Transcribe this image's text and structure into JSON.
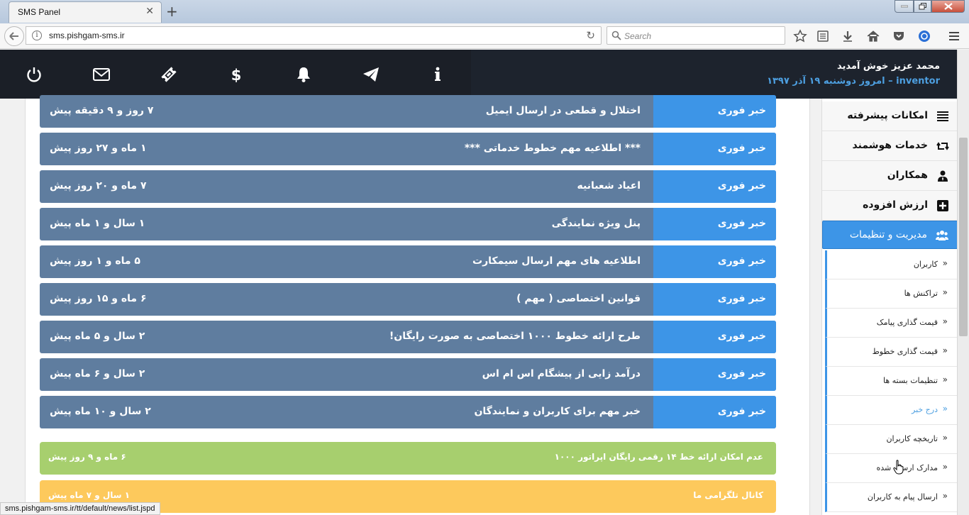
{
  "browser": {
    "tab_title": "SMS Panel",
    "url": "sms.pishgam-sms.ir",
    "search_placeholder": "Search",
    "status_url": "sms.pishgam-sms.ir/tt/default/news/list.jspd"
  },
  "header": {
    "welcome": "محمد عزیز خوش آمدید",
    "username": "inventor",
    "date_text": "– امروز دوشنبه ۱۹ آذر ۱۳۹۷",
    "icons": [
      "power-icon",
      "mail-icon",
      "ticket-icon",
      "dollar-icon",
      "bell-icon",
      "send-icon",
      "info-icon"
    ]
  },
  "news": [
    {
      "badge": "خبر فوری",
      "title": "اختلال و قطعی در ارسال ایمیل",
      "time": "۷ روز و ۹ دقیقه پیش"
    },
    {
      "badge": "خبر فوری",
      "title": "*** اطلاعیه مهم خطوط خدماتی ***",
      "time": "۱ ماه و ۲۷ روز پیش"
    },
    {
      "badge": "خبر فوری",
      "title": "اعیاد شعبانیه",
      "time": "۷ ماه و ۲۰ روز پیش"
    },
    {
      "badge": "خبر فوری",
      "title": "پنل ویژه نمایندگی",
      "time": "۱ سال و ۱ ماه پیش"
    },
    {
      "badge": "خبر فوری",
      "title": "اطلاعیه های مهم ارسال سیمکارت",
      "time": "۵ ماه و ۱ روز پیش"
    },
    {
      "badge": "خبر فوری",
      "title": "قوانین اختصاصی ( مهم )",
      "time": "۶ ماه و ۱۵ روز پیش"
    },
    {
      "badge": "خبر فوری",
      "title": "طرح ارائه خطوط ۱۰۰۰ اختصاصی به صورت رایگان!",
      "time": "۲ سال و ۵ ماه پیش"
    },
    {
      "badge": "خبر فوری",
      "title": "درآمد زایی از پیشگام اس ام اس",
      "time": "۲ سال و ۶ ماه پیش"
    },
    {
      "badge": "خبر فوری",
      "title": "خبر مهم برای کاربران و نمایندگان",
      "time": "۲ سال و ۱۰ ماه پیش"
    }
  ],
  "alerts": [
    {
      "title": "عدم امکان ارائه خط ۱۴ رقمی رایگان اپراتور ۱۰۰۰",
      "time": "۶ ماه و ۹ روز پیش",
      "color": "#a7cf6e"
    },
    {
      "title": "کانال تلگرامی ما",
      "time": "۱ سال و ۷ ماه پیش",
      "color": "#fdc95c"
    }
  ],
  "sidebar": {
    "items": [
      {
        "label": "امکانات پیشرفته",
        "icon": "list-icon"
      },
      {
        "label": "خدمات هوشمند",
        "icon": "retweet-icon"
      },
      {
        "label": "همکاران",
        "icon": "user-tie-icon"
      },
      {
        "label": "ارزش افزوده",
        "icon": "plus-square-icon"
      }
    ],
    "active": {
      "label": "مدیریت و تنظیمات",
      "icon": "users-icon"
    },
    "subitems": [
      {
        "label": "کاربران"
      },
      {
        "label": "تراکنش ها"
      },
      {
        "label": "قیمت گذاری پیامک"
      },
      {
        "label": "قیمت گذاری خطوط"
      },
      {
        "label": "تنظیمات بسته ها"
      },
      {
        "label": "درج خبر"
      },
      {
        "label": "تاریخچه کاربران"
      },
      {
        "label": "مدارک ارسال شده"
      },
      {
        "label": "ارسال پیام به کاربران"
      }
    ],
    "hovered_subitem": "درج خبر"
  },
  "colors": {
    "topbar": "#1b1f27",
    "news_row": "#5f7d9f",
    "news_badge": "#3d95e7",
    "accent": "#4d9fe0"
  }
}
